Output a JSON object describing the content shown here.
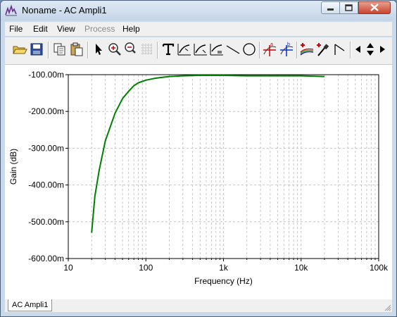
{
  "window": {
    "title": "Noname - AC Ampli1"
  },
  "menu": {
    "file": "File",
    "edit": "Edit",
    "view": "View",
    "process": "Process",
    "help": "Help"
  },
  "toolbar": {
    "icons": [
      "open-folder-icon",
      "save-icon",
      "copy-icon",
      "paste-icon",
      "pointer-icon",
      "zoom-in-icon",
      "zoom-out-icon",
      "grid-icon",
      "text-tool-icon",
      "curve-tool-1-icon",
      "curve-tool-2-icon",
      "curve-tool-3-icon",
      "line-tool-icon",
      "circle-tool-icon",
      "cursor-a-icon",
      "cursor-b-icon",
      "add-trace-icon",
      "probe-icon",
      "marker-icon",
      "arrow-left-icon",
      "arrow-updown-icon",
      "arrow-right-icon"
    ]
  },
  "status": {
    "tab": "AC Ampli1"
  },
  "chart_data": {
    "type": "line",
    "title": "",
    "xlabel": "Frequency (Hz)",
    "ylabel": "Gain (dB)",
    "x_scale": "log",
    "xlim": [
      10,
      100000
    ],
    "ylim": [
      -0.6,
      -0.1
    ],
    "x_tick_labels": [
      "10",
      "100",
      "1k",
      "10k",
      "100k"
    ],
    "y_tick_labels": [
      "-100.00m",
      "-200.00m",
      "-300.00m",
      "-400.00m",
      "-500.00m",
      "-600.00m"
    ],
    "grid": true,
    "colors": {
      "trace": "#008000"
    },
    "series": [
      {
        "x": [
          20,
          22,
          25,
          30,
          35,
          40,
          50,
          60,
          70,
          80,
          100,
          130,
          150,
          200,
          300,
          500,
          1000,
          2000,
          5000,
          10000,
          20000
        ],
        "y": [
          -0.53,
          -0.43,
          -0.36,
          -0.28,
          -0.24,
          -0.205,
          -0.165,
          -0.145,
          -0.13,
          -0.122,
          -0.115,
          -0.11,
          -0.108,
          -0.105,
          -0.103,
          -0.102,
          -0.102,
          -0.103,
          -0.103,
          -0.103,
          -0.105
        ]
      }
    ]
  }
}
